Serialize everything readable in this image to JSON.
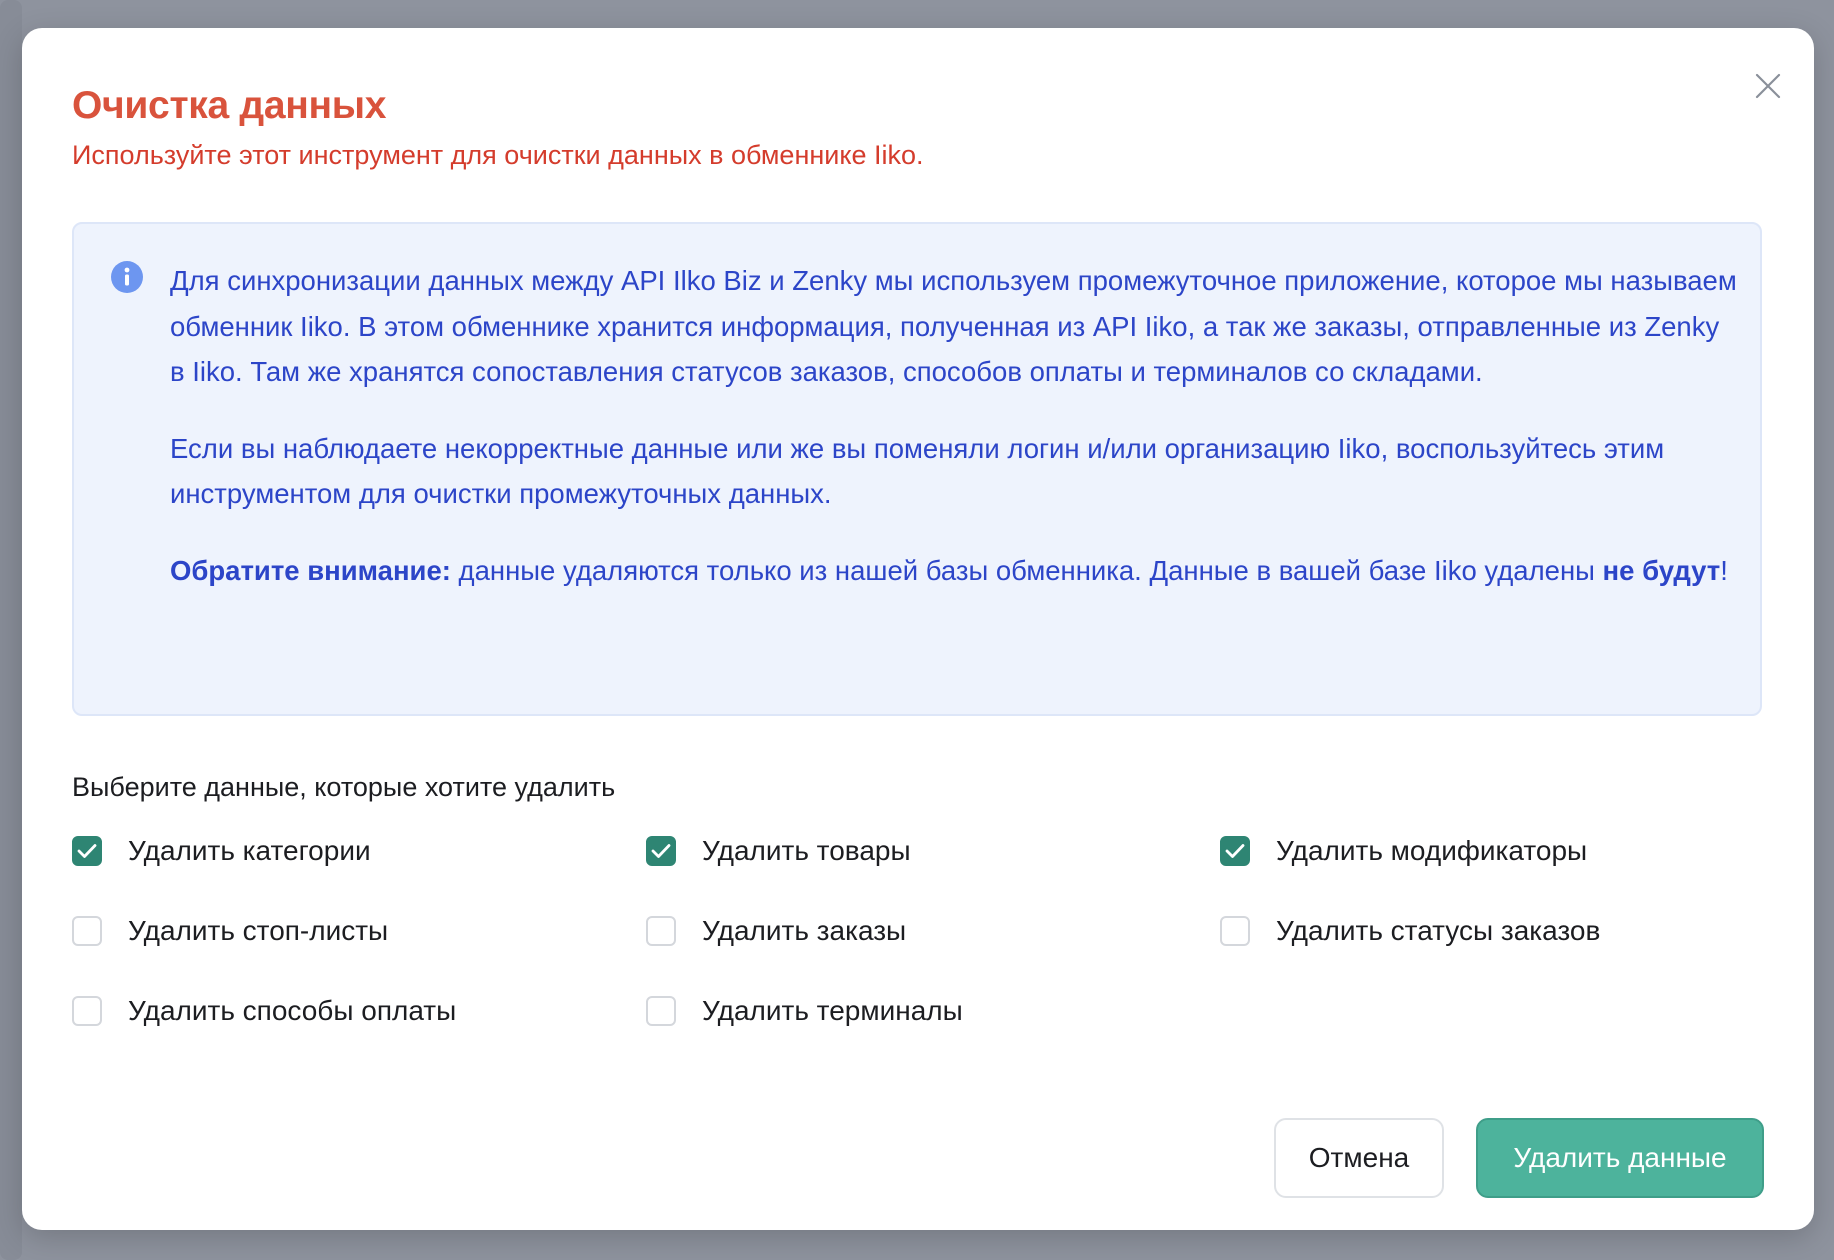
{
  "modal": {
    "title": "Очистка данных",
    "subtitle": "Используйте этот инструмент для очистки данных в обменнике Iiko."
  },
  "info": {
    "icon": "info-icon",
    "paragraph1": "Для синхронизации данных между API Ilko Biz и Zenky мы используем промежуточное приложение, которое мы называем обменник Iiko. В этом обменнике хранится информация, полученная из API Iiko, а так же заказы, отправленные из Zenky в Iiko. Там же хранятся сопоставления статусов заказов, способов оплаты и терминалов со складами.",
    "paragraph2": "Если вы наблюдаете некорректные данные или же вы поменяли логин и/или организацию Iiko, воспользуйтесь этим инструментом для очистки промежуточных данных.",
    "note_bold": "Обратите внимание:",
    "note_text": " данные удаляются только из нашей базы обменника. Данные в вашей базе Iiko удалены ",
    "note_emphasis": "не будут",
    "note_end": "!"
  },
  "selection": {
    "label": "Выберите данные, которые хотите удалить",
    "options": [
      {
        "label": "Удалить категории",
        "checked": true
      },
      {
        "label": "Удалить товары",
        "checked": true
      },
      {
        "label": "Удалить модификаторы",
        "checked": true
      },
      {
        "label": "Удалить стоп-листы",
        "checked": false
      },
      {
        "label": "Удалить заказы",
        "checked": false
      },
      {
        "label": "Удалить статусы заказов",
        "checked": false
      },
      {
        "label": "Удалить способы оплаты",
        "checked": false
      },
      {
        "label": "Удалить терминалы",
        "checked": false
      }
    ]
  },
  "buttons": {
    "cancel": "Отмена",
    "delete": "Удалить данные"
  },
  "colors": {
    "title": "#d9533c",
    "subtitle": "#d43c2c",
    "info_text": "#2c45c8",
    "info_bg": "#eef3fd",
    "checkbox_checked": "#2e8573",
    "primary_button": "#4db39c"
  }
}
